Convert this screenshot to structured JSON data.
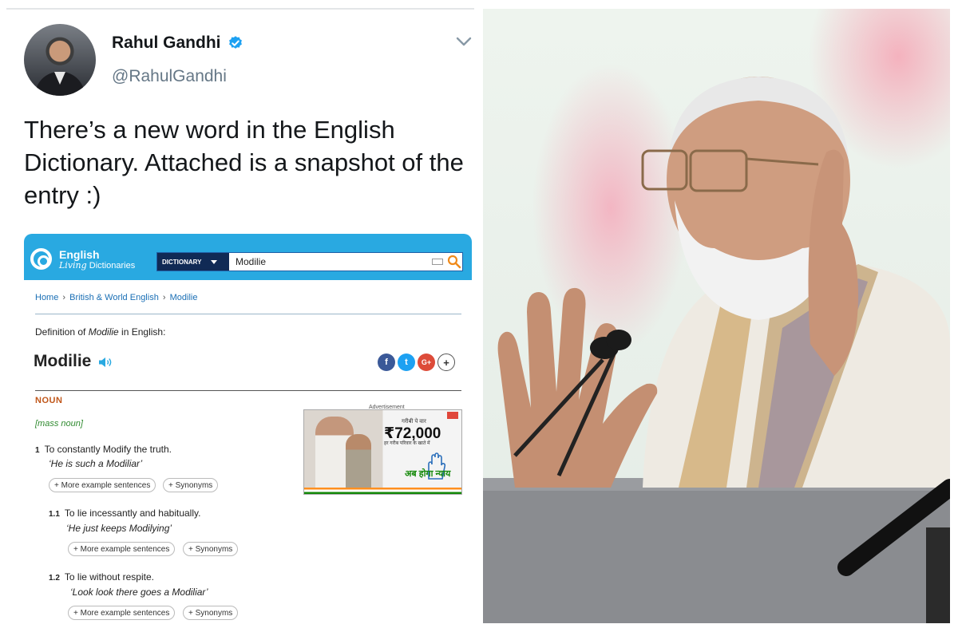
{
  "tweet": {
    "name": "Rahul Gandhi",
    "handle": "@RahulGandhi",
    "text": "There’s a new word in the English Dictionary. Attached is a snapshot of the entry :)"
  },
  "dictionary": {
    "logo_line1": "English",
    "logo_line2_italic": "Living",
    "logo_line2_rest": " Dictionaries",
    "search_type": "DICTIONARY",
    "search_value": "Modilie",
    "breadcrumb": [
      "Home",
      "British & World English",
      "Modilie"
    ],
    "definition_prefix": "Definition of ",
    "definition_word": "Modilie",
    "definition_suffix": " in English:",
    "headword": "Modilie",
    "share": {
      "facebook": "f",
      "twitter": "t",
      "google": "G+",
      "more": "+"
    },
    "part_of_speech": "NOUN",
    "grammar": "[mass noun]",
    "senses": [
      {
        "num": "1",
        "definition": "To constantly Modify the truth.",
        "example": "‘He is such a Modiliar’"
      },
      {
        "num": "1.1",
        "definition": "To lie incessantly and habitually.",
        "example": "‘He just keeps Modilying’"
      },
      {
        "num": "1.2",
        "definition": "To lie without respite.",
        "example": "‘Look look there goes a Modiliar’"
      }
    ],
    "more_examples_label": "+ More example sentences",
    "synonyms_label": "+ Synonyms",
    "ad": {
      "label": "Advertisement",
      "line1": "गरीबी पे वार",
      "amount": "₹72,000",
      "line2": "हर गरीब परिवार के खाते में",
      "slogan": "अब होगा न्याय"
    }
  },
  "colors": {
    "header_blue": "#29a9e1",
    "search_dark": "#102a55",
    "link_blue": "#1a6fb5",
    "pos_orange": "#c0571a",
    "grammar_green": "#2f8a2f",
    "verified_blue": "#1da1f2"
  },
  "icons": [
    "verified-badge-icon",
    "chevron-down-icon",
    "keyboard-icon",
    "search-icon",
    "speaker-icon",
    "facebook-icon",
    "twitter-icon",
    "google-plus-icon",
    "plus-icon"
  ]
}
